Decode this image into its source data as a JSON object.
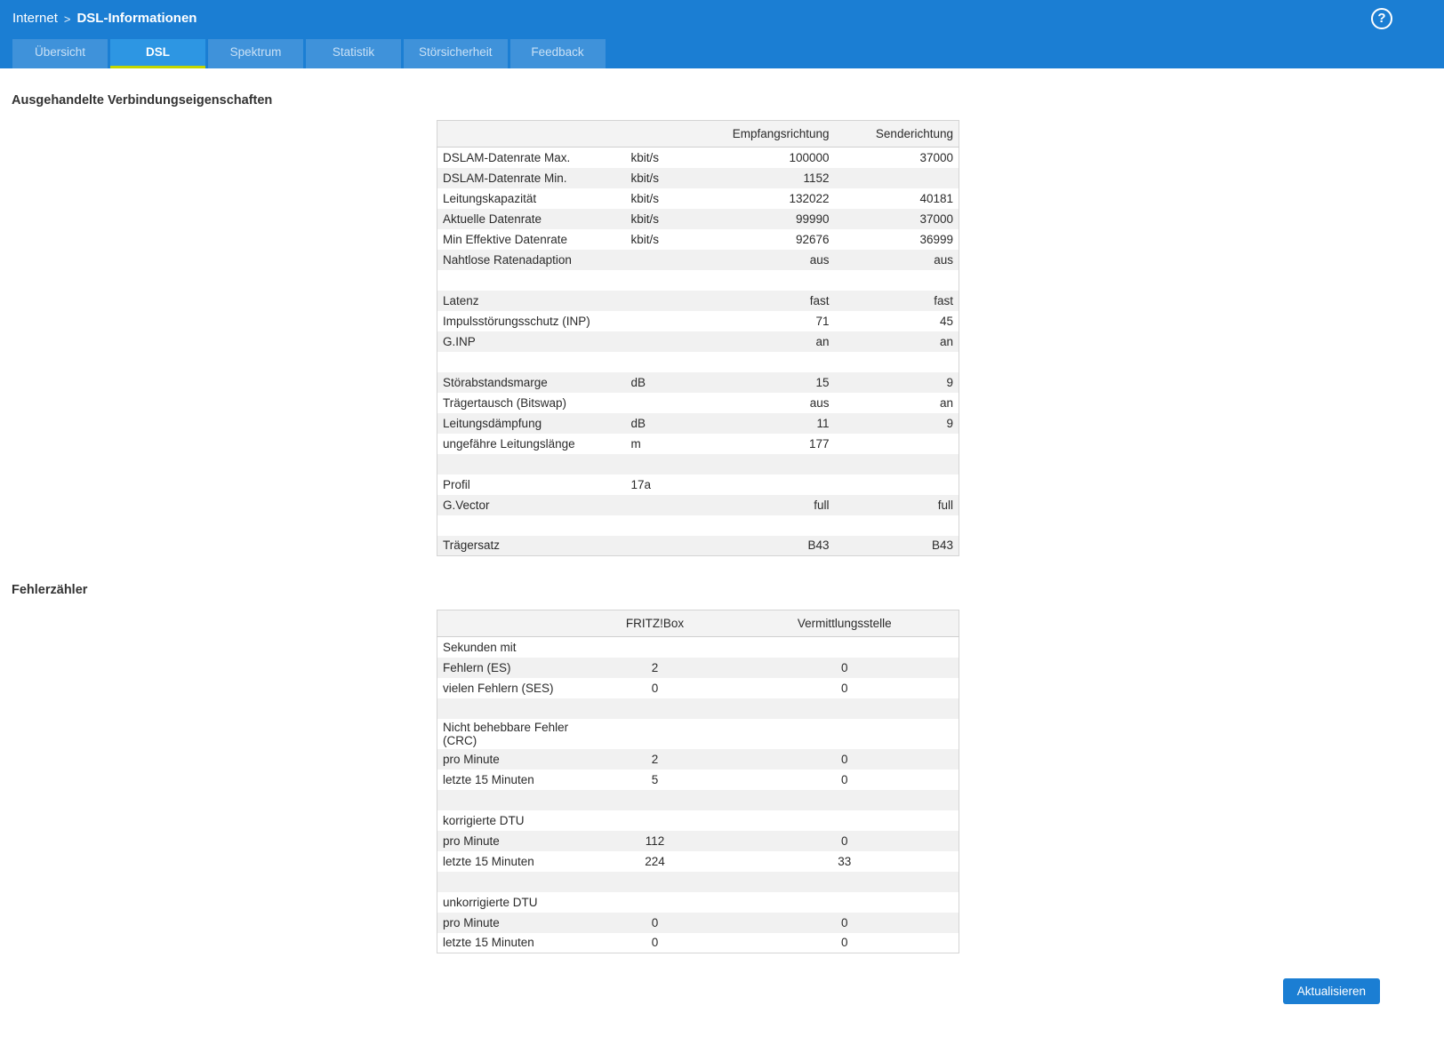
{
  "colors": {
    "brand_blue": "#1b7ed3",
    "active_tab_underline": "#c3d600",
    "row_alt": "#f1f1f1"
  },
  "header": {
    "breadcrumb_parent": "Internet",
    "breadcrumb_separator": ">",
    "breadcrumb_current": "DSL-Informationen",
    "help_label": "?"
  },
  "tabs": [
    {
      "id": "uebersicht",
      "label": "Übersicht",
      "active": false
    },
    {
      "id": "dsl",
      "label": "DSL",
      "active": true
    },
    {
      "id": "spektrum",
      "label": "Spektrum",
      "active": false
    },
    {
      "id": "statistik",
      "label": "Statistik",
      "active": false
    },
    {
      "id": "stoersicherheit",
      "label": "Störsicherheit",
      "active": false
    },
    {
      "id": "feedback",
      "label": "Feedback",
      "active": false
    }
  ],
  "connection": {
    "title": "Ausgehandelte Verbindungseigenschaften",
    "columns": {
      "rx": "Empfangsrichtung",
      "tx": "Senderichtung"
    },
    "rows": [
      {
        "label": "DSLAM-Datenrate Max.",
        "unit": "kbit/s",
        "rx": "100000",
        "tx": "37000"
      },
      {
        "label": "DSLAM-Datenrate Min.",
        "unit": "kbit/s",
        "rx": "1152",
        "tx": ""
      },
      {
        "label": "Leitungskapazität",
        "unit": "kbit/s",
        "rx": "132022",
        "tx": "40181"
      },
      {
        "label": "Aktuelle Datenrate",
        "unit": "kbit/s",
        "rx": "99990",
        "tx": "37000"
      },
      {
        "label": "Min Effektive Datenrate",
        "unit": "kbit/s",
        "rx": "92676",
        "tx": "36999"
      },
      {
        "label": "Nahtlose Ratenadaption",
        "unit": "",
        "rx": "aus",
        "tx": "aus"
      },
      {
        "label": "",
        "unit": "",
        "rx": "",
        "tx": ""
      },
      {
        "label": "Latenz",
        "unit": "",
        "rx": "fast",
        "tx": "fast"
      },
      {
        "label": "Impulsstörungsschutz (INP)",
        "unit": "",
        "rx": "71",
        "tx": "45"
      },
      {
        "label": "G.INP",
        "unit": "",
        "rx": "an",
        "tx": "an"
      },
      {
        "label": "",
        "unit": "",
        "rx": "",
        "tx": ""
      },
      {
        "label": "Störabstandsmarge",
        "unit": "dB",
        "rx": "15",
        "tx": "9"
      },
      {
        "label": "Trägertausch (Bitswap)",
        "unit": "",
        "rx": "aus",
        "tx": "an"
      },
      {
        "label": "Leitungsdämpfung",
        "unit": "dB",
        "rx": "11",
        "tx": "9"
      },
      {
        "label": "ungefähre Leitungslänge",
        "unit": "m",
        "rx": "177",
        "tx": ""
      },
      {
        "label": "",
        "unit": "",
        "rx": "",
        "tx": ""
      },
      {
        "label": "Profil",
        "unit": "17a",
        "rx": "",
        "tx": ""
      },
      {
        "label": "G.Vector",
        "unit": "",
        "rx": "full",
        "tx": "full"
      },
      {
        "label": "",
        "unit": "",
        "rx": "",
        "tx": ""
      },
      {
        "label": "Trägersatz",
        "unit": "",
        "rx": "B43",
        "tx": "B43"
      }
    ]
  },
  "errors": {
    "title": "Fehlerzähler",
    "columns": {
      "fb": "FRITZ!Box",
      "vst": "Vermittlungsstelle"
    },
    "rows": [
      {
        "label": "Sekunden mit",
        "fb": "",
        "vst": ""
      },
      {
        "label": "Fehlern (ES)",
        "fb": "2",
        "vst": "0"
      },
      {
        "label": "vielen Fehlern (SES)",
        "fb": "0",
        "vst": "0"
      },
      {
        "label": "",
        "fb": "",
        "vst": ""
      },
      {
        "label": "Nicht behebbare Fehler (CRC)",
        "fb": "",
        "vst": ""
      },
      {
        "label": "pro Minute",
        "fb": "2",
        "vst": "0"
      },
      {
        "label": "letzte 15 Minuten",
        "fb": "5",
        "vst": "0"
      },
      {
        "label": "",
        "fb": "",
        "vst": ""
      },
      {
        "label": "korrigierte DTU",
        "fb": "",
        "vst": ""
      },
      {
        "label": "pro Minute",
        "fb": "112",
        "vst": "0"
      },
      {
        "label": "letzte 15 Minuten",
        "fb": "224",
        "vst": "33"
      },
      {
        "label": "",
        "fb": "",
        "vst": ""
      },
      {
        "label": "unkorrigierte DTU",
        "fb": "",
        "vst": ""
      },
      {
        "label": "pro Minute",
        "fb": "0",
        "vst": "0"
      },
      {
        "label": "letzte 15 Minuten",
        "fb": "0",
        "vst": "0"
      }
    ]
  },
  "footer": {
    "refresh_label": "Aktualisieren"
  }
}
